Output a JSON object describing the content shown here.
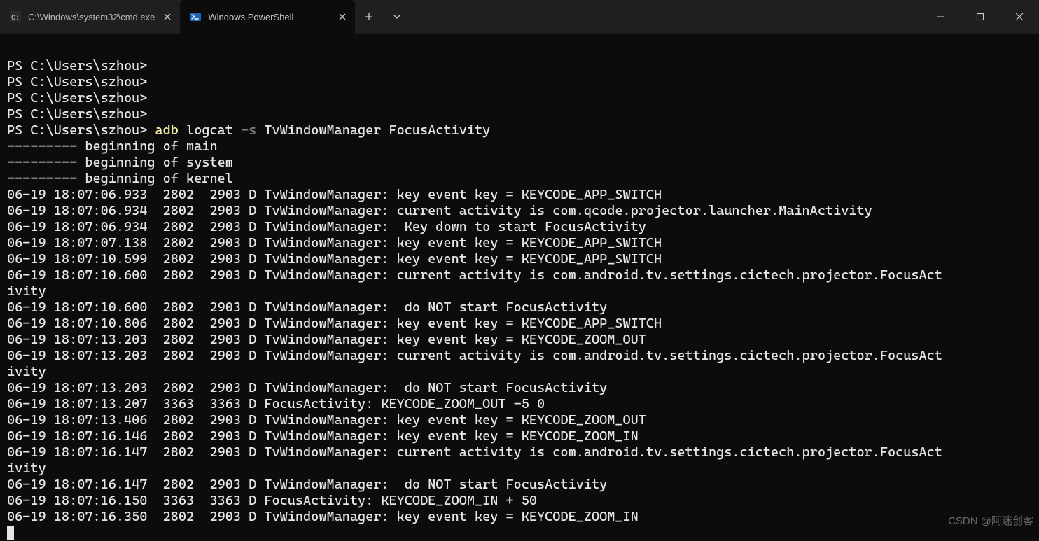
{
  "tabs": [
    {
      "title": "C:\\Windows\\system32\\cmd.exe",
      "icon": "cmd"
    },
    {
      "title": "Windows PowerShell",
      "icon": "powershell"
    }
  ],
  "prompts": {
    "p0": "PS C:\\Users\\szhou>",
    "p1": "PS C:\\Users\\szhou>",
    "p2": "PS C:\\Users\\szhou>",
    "p3": "PS C:\\Users\\szhou>",
    "p4": "PS C:\\Users\\szhou> "
  },
  "cmd": {
    "adb": "adb",
    "logcat": " logcat ",
    "flag": "-s",
    "args": " TvWindowManager FocusActivity"
  },
  "lines": {
    "l0": "--------- beginning of main",
    "l1": "--------- beginning of system",
    "l2": "--------- beginning of kernel",
    "l3": "06-19 18:07:06.933  2802  2903 D TvWindowManager: key event key = KEYCODE_APP_SWITCH",
    "l4": "06-19 18:07:06.934  2802  2903 D TvWindowManager: current activity is com.qcode.projector.launcher.MainActivity",
    "l5": "06-19 18:07:06.934  2802  2903 D TvWindowManager:  Key down to start FocusActivity",
    "l6": "06-19 18:07:07.138  2802  2903 D TvWindowManager: key event key = KEYCODE_APP_SWITCH",
    "l7": "06-19 18:07:10.599  2802  2903 D TvWindowManager: key event key = KEYCODE_APP_SWITCH",
    "l8": "06-19 18:07:10.600  2802  2903 D TvWindowManager: current activity is com.android.tv.settings.cictech.projector.FocusAct",
    "l8b": "ivity",
    "l9": "06-19 18:07:10.600  2802  2903 D TvWindowManager:  do NOT start FocusActivity",
    "l10": "06-19 18:07:10.806  2802  2903 D TvWindowManager: key event key = KEYCODE_APP_SWITCH",
    "l11": "06-19 18:07:13.203  2802  2903 D TvWindowManager: key event key = KEYCODE_ZOOM_OUT",
    "l12": "06-19 18:07:13.203  2802  2903 D TvWindowManager: current activity is com.android.tv.settings.cictech.projector.FocusAct",
    "l12b": "ivity",
    "l13": "06-19 18:07:13.203  2802  2903 D TvWindowManager:  do NOT start FocusActivity",
    "l14": "06-19 18:07:13.207  3363  3363 D FocusActivity: KEYCODE_ZOOM_OUT -5 0",
    "l15": "06-19 18:07:13.406  2802  2903 D TvWindowManager: key event key = KEYCODE_ZOOM_OUT",
    "l16": "06-19 18:07:16.146  2802  2903 D TvWindowManager: key event key = KEYCODE_ZOOM_IN",
    "l17": "06-19 18:07:16.147  2802  2903 D TvWindowManager: current activity is com.android.tv.settings.cictech.projector.FocusAct",
    "l17b": "ivity",
    "l18": "06-19 18:07:16.147  2802  2903 D TvWindowManager:  do NOT start FocusActivity",
    "l19": "06-19 18:07:16.150  3363  3363 D FocusActivity: KEYCODE_ZOOM_IN + 50",
    "l20": "06-19 18:07:16.350  2802  2903 D TvWindowManager: key event key = KEYCODE_ZOOM_IN"
  },
  "watermark": "CSDN @阿迷创客"
}
